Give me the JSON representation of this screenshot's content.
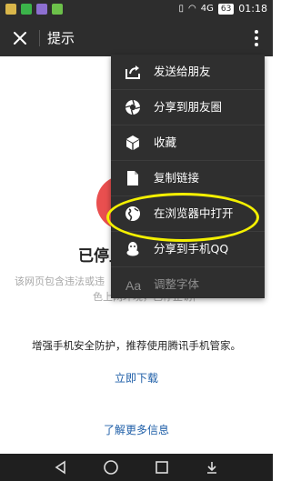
{
  "status_bar": {
    "battery": "63",
    "time": "01:18",
    "signal_text": "4G"
  },
  "title_bar": {
    "title": "提示"
  },
  "page": {
    "stop_title": "已停止",
    "desc_line1": "该网页包含违法或违",
    "desc_line2": "色上网环境，已停止访问",
    "promo": "增强手机安全防护，推荐使用腾讯手机管家。",
    "download": "立即下载",
    "more_info": "了解更多信息"
  },
  "menu": {
    "items": [
      {
        "label": "发送给朋友",
        "icon": "share-arrow-icon"
      },
      {
        "label": "分享到朋友圈",
        "icon": "moments-aperture-icon"
      },
      {
        "label": "收藏",
        "icon": "favorite-cube-icon"
      },
      {
        "label": "复制链接",
        "icon": "document-icon"
      },
      {
        "label": "在浏览器中打开",
        "icon": "globe-icon"
      },
      {
        "label": "分享到手机QQ",
        "icon": "qq-penguin-icon"
      },
      {
        "label": "调整字体",
        "icon": "font-size-icon"
      }
    ]
  },
  "colors": {
    "bar": "#2d2d2d",
    "menu_bg": "#2f2f2f",
    "highlight": "#f4f000",
    "link": "#1f5fa8",
    "warning_red": "#e94f4f"
  }
}
